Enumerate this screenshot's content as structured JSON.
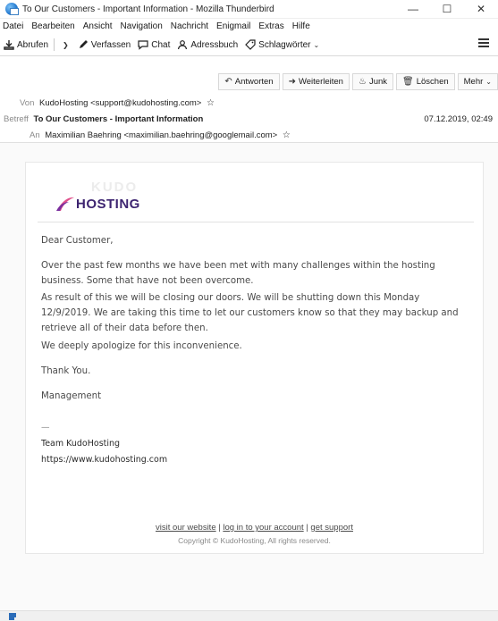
{
  "window": {
    "title": "To Our Customers - Important Information - Mozilla Thunderbird",
    "minimize": "—",
    "maximize": "☐",
    "close": "✕"
  },
  "menu": [
    "Datei",
    "Bearbeiten",
    "Ansicht",
    "Navigation",
    "Nachricht",
    "Enigmail",
    "Extras",
    "Hilfe"
  ],
  "toolbar": {
    "fetch": "Abrufen",
    "compose": "Verfassen",
    "chat": "Chat",
    "addressbook": "Adressbuch",
    "tags": "Schlagwörter"
  },
  "actions": {
    "reply": "Antworten",
    "forward": "Weiterleiten",
    "junk": "Junk",
    "delete": "Löschen",
    "more": "Mehr"
  },
  "header": {
    "from_label": "Von",
    "from": "KudoHosting <support@kudohosting.com>",
    "subject_label": "Betreff",
    "subject": "To Our Customers - Important Information",
    "date": "07.12.2019, 02:49",
    "to_label": "An",
    "to": "Maximilian Baehring <maximilian.baehring@googlemail.com>"
  },
  "email": {
    "logo_ghost": "KUDO",
    "logo_text": "HOSTING",
    "greeting": "Dear Customer,",
    "p1": "Over the past few months we have been met with many challenges within the hosting business. Some that have not been overcome.",
    "p2": "As result of this we will be closing our doors.  We will be shutting down this Monday 12/9/2019.  We are taking this time to let our customers know so that they may backup and retrieve all of their data before then.",
    "p3": "We deeply apologize for this inconvenience.",
    "thanks": "Thank You.",
    "management": "Management",
    "sig_dash": "—",
    "sig_team": "Team KudoHosting",
    "sig_url": "https://www.kudohosting.com",
    "footer_link1": "visit our website",
    "footer_link2": "log in to your account",
    "footer_link3": "get support",
    "footer_sep": "|",
    "copyright": "Copyright © KudoHosting, All rights reserved."
  },
  "colors": {
    "logo_text": "#3d2470",
    "logo_mark": "#e0508c",
    "window_bg": "#fafafa"
  }
}
